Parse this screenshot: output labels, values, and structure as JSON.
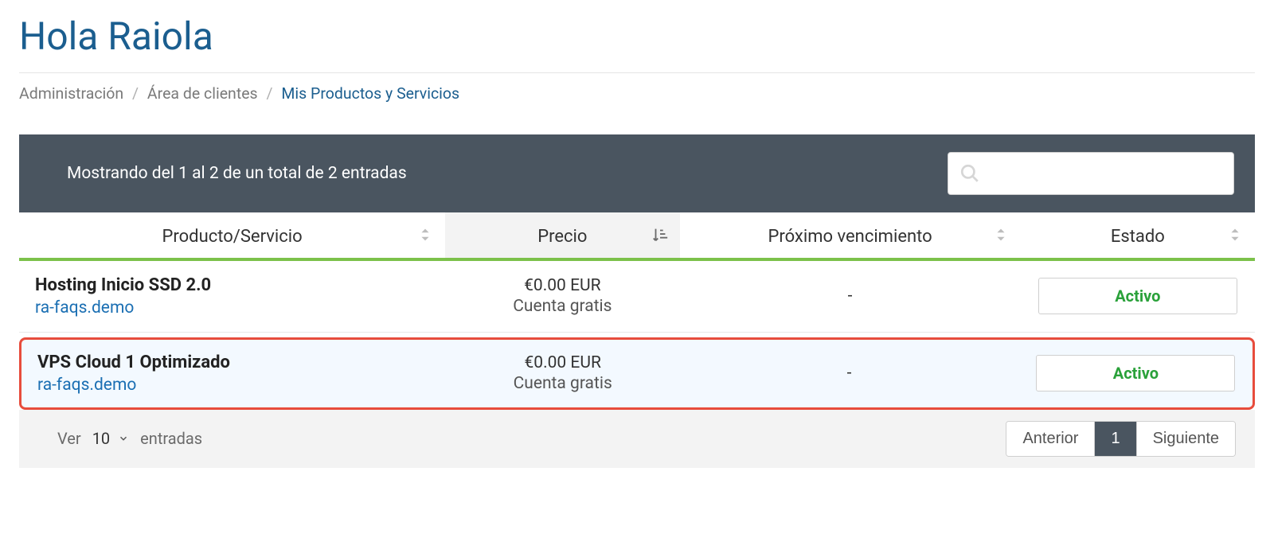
{
  "page": {
    "title": "Hola Raiola"
  },
  "breadcrumb": {
    "items": [
      "Administración",
      "Área de clientes"
    ],
    "current": "Mis Productos y Servicios"
  },
  "table": {
    "showing_text": "Mostrando del 1 al 2 de un total de 2 entradas",
    "search_placeholder": "",
    "columns": {
      "product": "Producto/Servicio",
      "price": "Precio",
      "next_due": "Próximo vencimiento",
      "status": "Estado"
    },
    "rows": [
      {
        "product_name": "Hosting Inicio SSD 2.0",
        "domain": "ra-faqs.demo",
        "price": "€0.00 EUR",
        "price_sub": "Cuenta gratis",
        "next_due": "-",
        "status": "Activo",
        "highlighted": false
      },
      {
        "product_name": "VPS Cloud 1 Optimizado",
        "domain": "ra-faqs.demo",
        "price": "€0.00 EUR",
        "price_sub": "Cuenta gratis",
        "next_due": "-",
        "status": "Activo",
        "highlighted": true
      }
    ]
  },
  "footer": {
    "ver_label": "Ver",
    "entries_value": "10",
    "entradas_label": "entradas",
    "prev": "Anterior",
    "page": "1",
    "next": "Siguiente"
  }
}
